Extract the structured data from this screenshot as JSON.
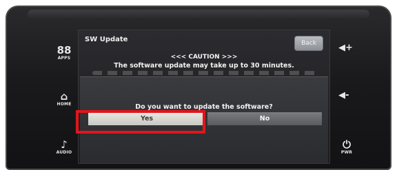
{
  "side_buttons": {
    "apps": {
      "glyph": "88",
      "label": "APPS"
    },
    "home": {
      "glyph": "⌂",
      "label": "HOME"
    },
    "audio": {
      "glyph": "♪",
      "label": "AUDIO"
    },
    "power": {
      "glyph": "⏻",
      "label": "PWR"
    }
  },
  "volume": {
    "up_icon": "speaker-plus",
    "down_icon": "speaker-minus",
    "up_glyph": "◀+",
    "down_glyph": "◀-"
  },
  "screen": {
    "title": "SW Update",
    "back_label": "Back",
    "caution_heading": "<<< CAUTION >>>",
    "caution_message": "The software update may take up to 30 minutes."
  },
  "dialog": {
    "question": "Do you want to update the software?",
    "yes_label": "Yes",
    "no_label": "No"
  },
  "colors": {
    "highlight": "#e3151b",
    "selected_button": "#e3e3de"
  }
}
